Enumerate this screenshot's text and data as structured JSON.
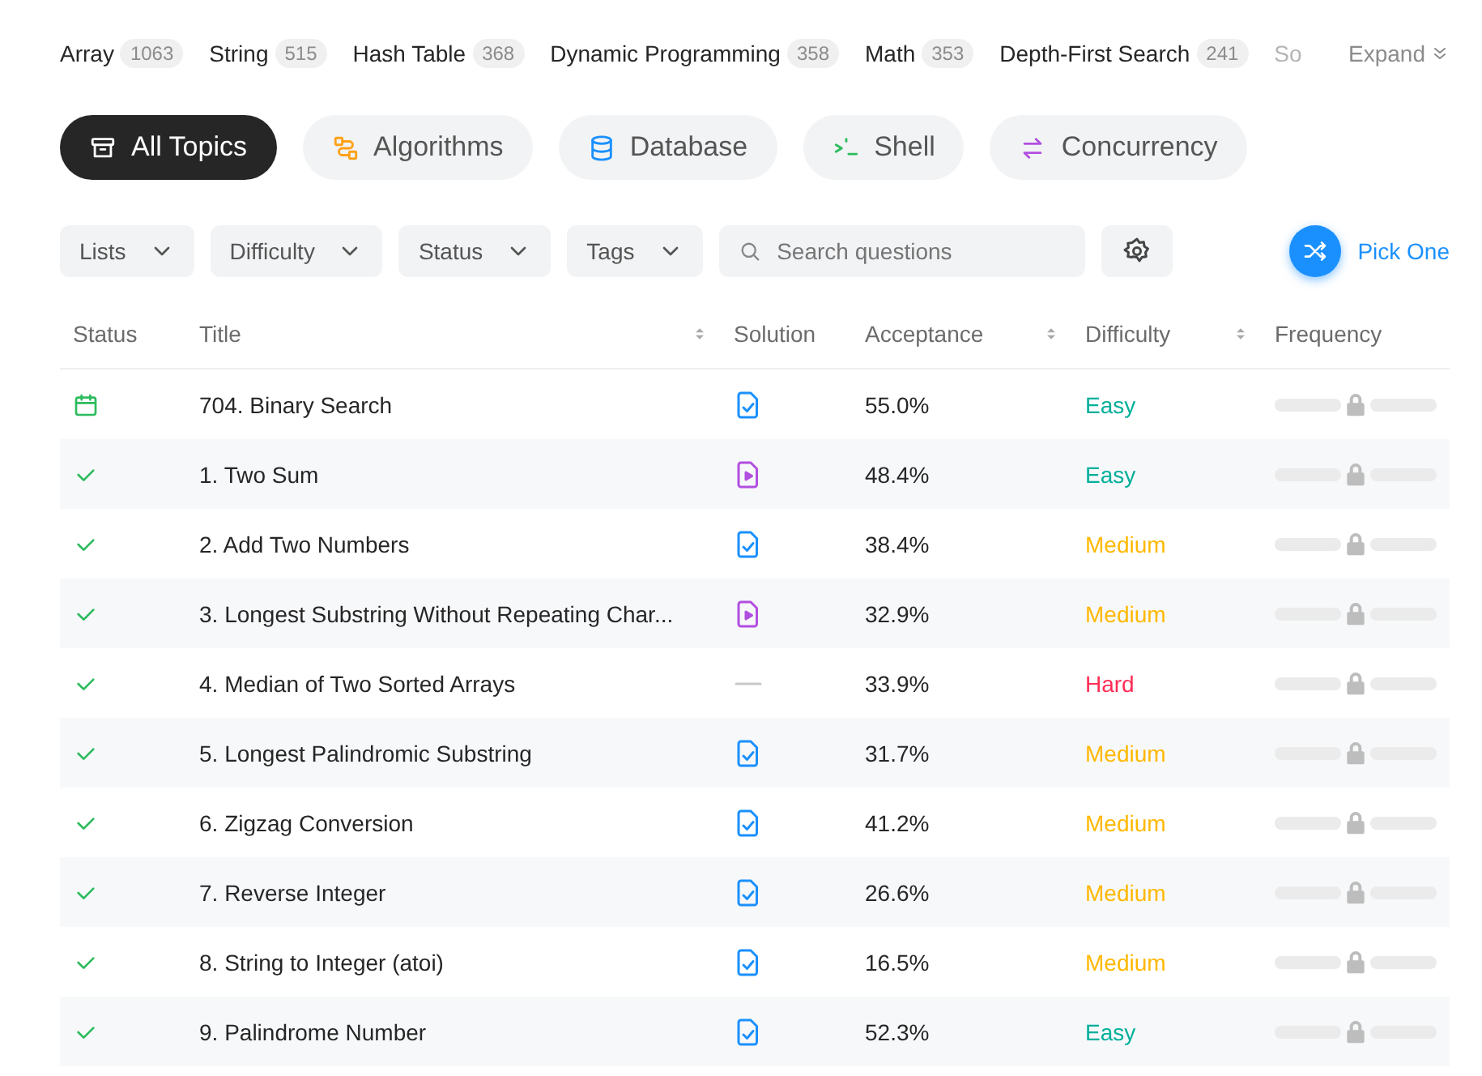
{
  "tags": [
    {
      "name": "Array",
      "count": "1063"
    },
    {
      "name": "String",
      "count": "515"
    },
    {
      "name": "Hash Table",
      "count": "368"
    },
    {
      "name": "Dynamic Programming",
      "count": "358"
    },
    {
      "name": "Math",
      "count": "353"
    },
    {
      "name": "Depth-First Search",
      "count": "241"
    },
    {
      "name": "So"
    }
  ],
  "expand": {
    "label": "Expand"
  },
  "topics": [
    {
      "label": "All Topics",
      "kind": "all",
      "selected": true
    },
    {
      "label": "Algorithms",
      "kind": "algorithms",
      "selected": false
    },
    {
      "label": "Database",
      "kind": "database",
      "selected": false
    },
    {
      "label": "Shell",
      "kind": "shell",
      "selected": false
    },
    {
      "label": "Concurrency",
      "kind": "concurrency",
      "selected": false
    }
  ],
  "filters": [
    "Lists",
    "Difficulty",
    "Status",
    "Tags"
  ],
  "search": {
    "placeholder": "Search questions"
  },
  "pick_one": {
    "label": "Pick One"
  },
  "table": {
    "columns": [
      {
        "label": "Status",
        "sortable": false
      },
      {
        "label": "Title",
        "sortable": true
      },
      {
        "label": "Solution",
        "sortable": false
      },
      {
        "label": "Acceptance",
        "sortable": true
      },
      {
        "label": "Difficulty",
        "sortable": true
      },
      {
        "label": "Frequency",
        "sortable": false
      }
    ],
    "rows": [
      {
        "status": {
          "kind": "daily"
        },
        "title": "704. Binary Search",
        "solution": {
          "kind": "article"
        },
        "acceptance": "55.0%",
        "difficulty": {
          "label": "Easy",
          "color": "#00af9b"
        }
      },
      {
        "status": {
          "kind": "solved"
        },
        "title": "1. Two Sum",
        "solution": {
          "kind": "video"
        },
        "acceptance": "48.4%",
        "difficulty": {
          "label": "Easy",
          "color": "#00af9b"
        }
      },
      {
        "status": {
          "kind": "solved"
        },
        "title": "2. Add Two Numbers",
        "solution": {
          "kind": "article"
        },
        "acceptance": "38.4%",
        "difficulty": {
          "label": "Medium",
          "color": "#ffb800"
        }
      },
      {
        "status": {
          "kind": "solved"
        },
        "title": "3. Longest Substring Without Repeating Char...",
        "solution": {
          "kind": "video"
        },
        "acceptance": "32.9%",
        "difficulty": {
          "label": "Medium",
          "color": "#ffb800"
        }
      },
      {
        "status": {
          "kind": "solved"
        },
        "title": "4. Median of Two Sorted Arrays",
        "solution": {
          "kind": "none"
        },
        "acceptance": "33.9%",
        "difficulty": {
          "label": "Hard",
          "color": "#ff2d55"
        }
      },
      {
        "status": {
          "kind": "solved"
        },
        "title": "5. Longest Palindromic Substring",
        "solution": {
          "kind": "article"
        },
        "acceptance": "31.7%",
        "difficulty": {
          "label": "Medium",
          "color": "#ffb800"
        }
      },
      {
        "status": {
          "kind": "solved"
        },
        "title": "6. Zigzag Conversion",
        "solution": {
          "kind": "article"
        },
        "acceptance": "41.2%",
        "difficulty": {
          "label": "Medium",
          "color": "#ffb800"
        }
      },
      {
        "status": {
          "kind": "solved"
        },
        "title": "7. Reverse Integer",
        "solution": {
          "kind": "article"
        },
        "acceptance": "26.6%",
        "difficulty": {
          "label": "Medium",
          "color": "#ffb800"
        }
      },
      {
        "status": {
          "kind": "solved"
        },
        "title": "8. String to Integer (atoi)",
        "solution": {
          "kind": "article"
        },
        "acceptance": "16.5%",
        "difficulty": {
          "label": "Medium",
          "color": "#ffb800"
        }
      },
      {
        "status": {
          "kind": "solved"
        },
        "title": "9. Palindrome Number",
        "solution": {
          "kind": "article"
        },
        "acceptance": "52.3%",
        "difficulty": {
          "label": "Easy",
          "color": "#00af9b"
        }
      }
    ]
  }
}
